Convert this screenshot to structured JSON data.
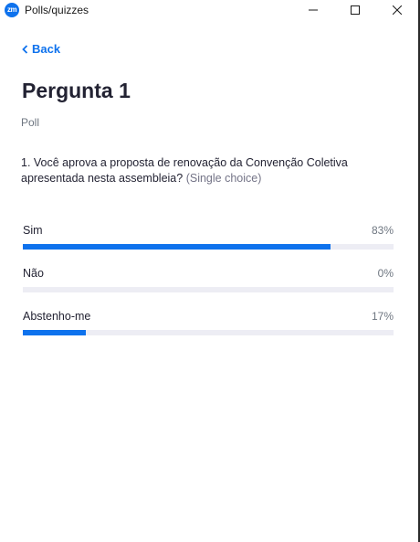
{
  "window": {
    "app_icon_text": "zm",
    "title": "Polls/quizzes"
  },
  "nav": {
    "back_label": "Back"
  },
  "poll": {
    "heading": "Pergunta 1",
    "type": "Poll",
    "question": "1. Você aprova a proposta de renovação da Convenção Coletiva apresentada nesta assembleia?",
    "question_hint": "(Single choice)",
    "results": [
      {
        "label": "Sim",
        "percent_text": "83%",
        "fraction": 0.83
      },
      {
        "label": "Não",
        "percent_text": "0%",
        "fraction": 0.0
      },
      {
        "label": "Abstenho-me",
        "percent_text": "17%",
        "fraction": 0.17
      }
    ]
  },
  "colors": {
    "accent": "#0e72ed",
    "bar_track": "#ededf4"
  }
}
